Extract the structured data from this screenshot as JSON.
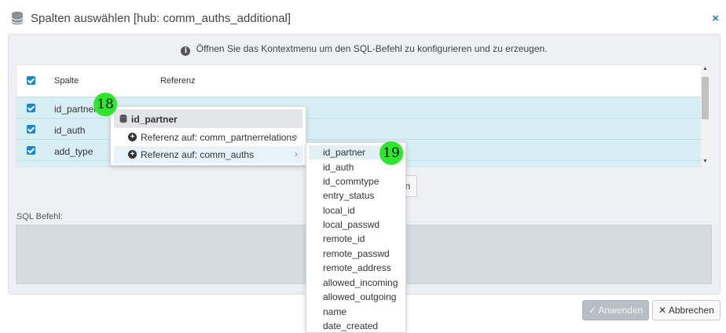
{
  "dialog": {
    "title": "Spalten auswählen [hub: comm_auths_additional]",
    "close_label": "×",
    "title_icon": "database-icon",
    "close_icon": "close-icon"
  },
  "info": {
    "icon_glyph": "i",
    "icon_name": "info-icon",
    "text": "Öffnen Sie das Kontextmenu um den SQL-Befehl zu konfigurieren und zu erzeugen."
  },
  "table": {
    "headers": {
      "spalte": "Spalte",
      "referenz": "Referenz"
    },
    "rows": [
      {
        "name": "id_partner",
        "checked": true
      },
      {
        "name": "id_auth",
        "checked": true
      },
      {
        "name": "add_type",
        "checked": true
      }
    ]
  },
  "hidden_button_fragment": "n",
  "sql": {
    "label": "SQL Befehl:"
  },
  "context_menu": {
    "header": "id_partner",
    "items": [
      {
        "label": "Referenz auf: comm_partnerrelations",
        "arrow": "›"
      },
      {
        "label": "Referenz auf: comm_auths",
        "arrow": "›",
        "active": true
      }
    ]
  },
  "submenu": {
    "items": [
      "id_partner",
      "id_auth",
      "id_commtype",
      "entry_status",
      "local_id",
      "local_passwd",
      "remote_id",
      "remote_passwd",
      "remote_address",
      "allowed_incoming",
      "allowed_outgoing",
      "name",
      "date_created"
    ]
  },
  "buttons": {
    "apply": "✓ Anwenden",
    "cancel": "✕ Abbrechen"
  },
  "markers": [
    "18",
    "19"
  ],
  "colors": {
    "accent": "#1e88c7",
    "row_selected": "#d8eef5",
    "marker": "#2ee62e"
  }
}
